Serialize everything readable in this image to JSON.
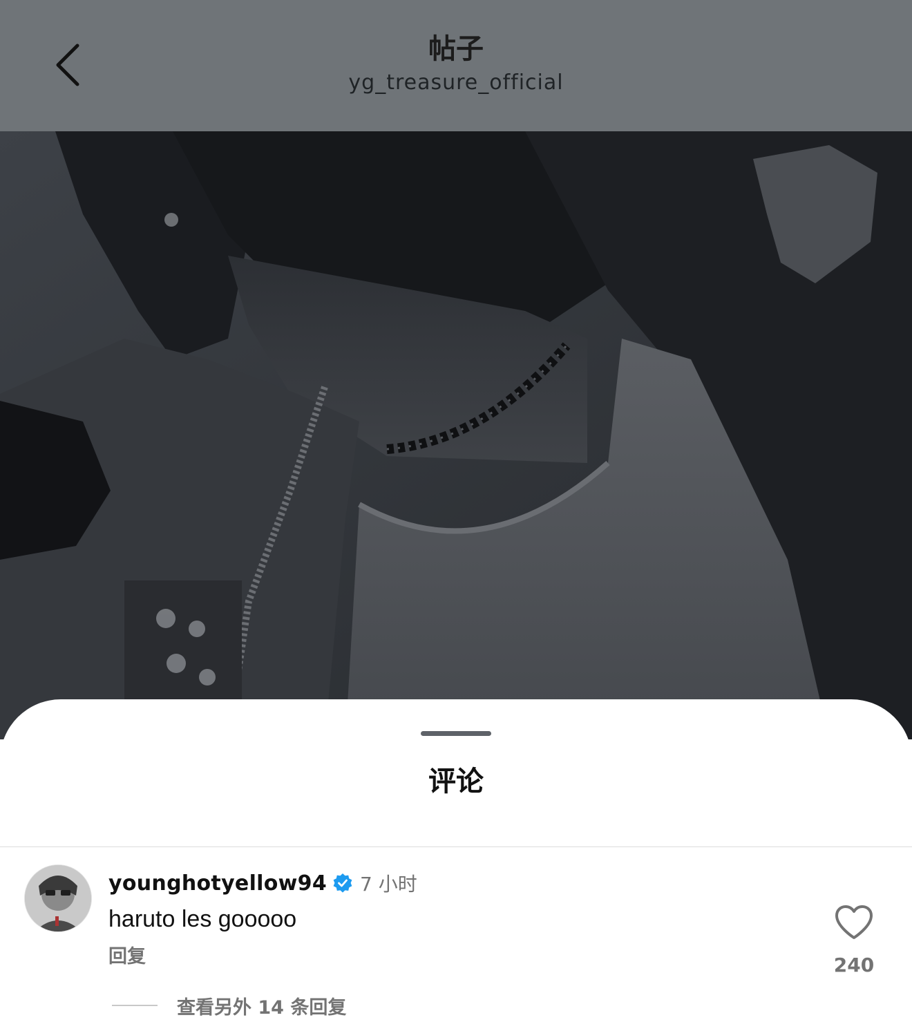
{
  "header": {
    "title": "帖子",
    "subtitle": "yg_treasure_official"
  },
  "comments_sheet": {
    "title": "评论",
    "comment": {
      "username": "younghotyellow94",
      "verified": true,
      "time": "7 小时",
      "text": "haruto les gooooo",
      "reply_label": "回复",
      "like_count": "240",
      "view_replies_label": "查看另外 14 条回复"
    }
  },
  "colors": {
    "topbar_bg": "#6f7478",
    "verified_badge": "#1d9bf0",
    "muted_text": "#737373"
  },
  "icons": {
    "back": "chevron-left-icon",
    "verified": "verified-badge-icon",
    "like": "heart-outline-icon"
  }
}
